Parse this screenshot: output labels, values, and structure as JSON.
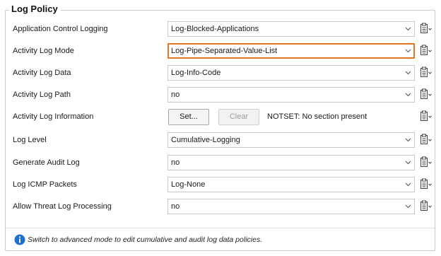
{
  "panel": {
    "title": "Log Policy"
  },
  "rows": [
    {
      "label": "Application Control Logging",
      "type": "select",
      "value": "Log-Blocked-Applications",
      "focused": false
    },
    {
      "label": "Activity Log Mode",
      "type": "select",
      "value": "Log-Pipe-Separated-Value-List",
      "focused": true
    },
    {
      "label": "Activity Log Data",
      "type": "select",
      "value": "Log-Info-Code",
      "focused": false
    },
    {
      "label": "Activity Log Path",
      "type": "select",
      "value": "no",
      "focused": false
    },
    {
      "label": "Activity Log Information",
      "type": "buttons",
      "set_label": "Set...",
      "clear_label": "Clear",
      "status": "NOTSET: No section present"
    },
    {
      "label": "Log Level",
      "type": "select",
      "value": "Cumulative-Logging",
      "focused": false
    },
    {
      "label": "Generate Audit Log",
      "type": "select",
      "value": "no",
      "focused": false
    },
    {
      "label": "Log ICMP Packets",
      "type": "select",
      "value": "Log-None",
      "focused": false
    },
    {
      "label": "Allow Threat Log Processing",
      "type": "select",
      "value": "no",
      "focused": false
    }
  ],
  "footer": {
    "info_text": "Switch to advanced mode to edit cumulative and audit log data policies."
  },
  "colors": {
    "focus_border": "#e57624",
    "info_icon": "#1f6fd1",
    "border": "#c8c8c8"
  },
  "icons": {
    "dropdown": "chevron-down-icon",
    "copy": "clipboard-copy-icon",
    "info": "info-icon"
  }
}
